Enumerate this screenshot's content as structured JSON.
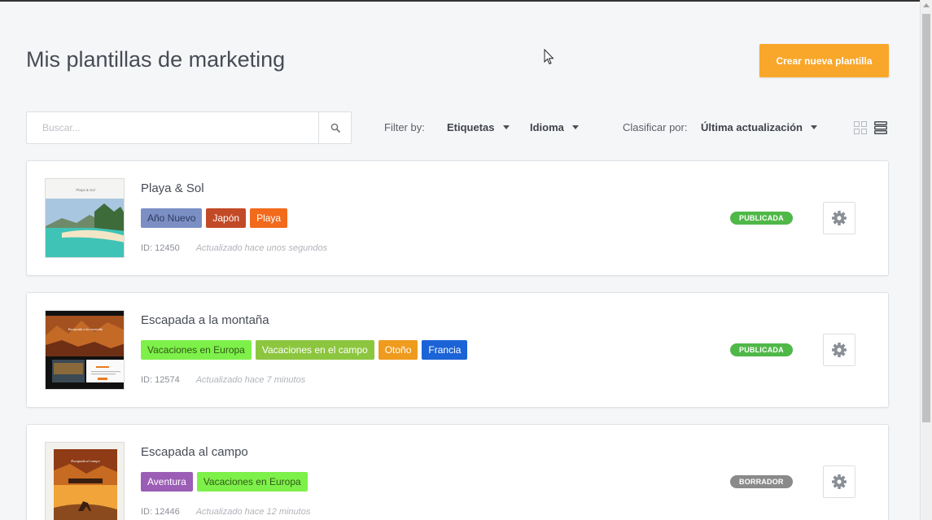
{
  "page": {
    "title": "Mis plantillas de marketing"
  },
  "actions": {
    "create_label": "Crear nueva plantilla"
  },
  "search": {
    "placeholder": "Buscar..."
  },
  "filters": {
    "filter_by_label": "Filter by:",
    "tags_label": "Etiquetas",
    "language_label": "Idioma",
    "sort_label": "Clasificar por:",
    "sort_value": "Última actualización"
  },
  "templates": [
    {
      "title": "Playa & Sol",
      "tags": [
        {
          "label": "Año Nuevo",
          "color": "#7b8fc4",
          "text_color": "#2c3a5e"
        },
        {
          "label": "Japón",
          "color": "#c24a26",
          "text_color": "#ffffff"
        },
        {
          "label": "Playa",
          "color": "#f26a1b",
          "text_color": "#ffffff"
        }
      ],
      "id_label": "ID: 12450",
      "updated": "Actualizado hace unos segundos",
      "status": "PUBLICADA",
      "status_color": "#4fb848",
      "thumb_text": "Playa & Sol"
    },
    {
      "title": "Escapada a la montaña",
      "tags": [
        {
          "label": "Vacaciones en Europa",
          "color": "#7ef04a",
          "text_color": "#2f5a17"
        },
        {
          "label": "Vacaciones en el campo",
          "color": "#8cc63f",
          "text_color": "#ffffff"
        },
        {
          "label": "Otoño",
          "color": "#ee9b1e",
          "text_color": "#ffffff"
        },
        {
          "label": "Francia",
          "color": "#1b63d6",
          "text_color": "#ffffff"
        }
      ],
      "id_label": "ID: 12574",
      "updated": "Actualizado hace 7 minutos",
      "status": "PUBLICADA",
      "status_color": "#4fb848",
      "thumb_text": "Escapada a la montaña"
    },
    {
      "title": "Escapada al campo",
      "tags": [
        {
          "label": "Aventura",
          "color": "#9b5db5",
          "text_color": "#ffffff"
        },
        {
          "label": "Vacaciones en Europa",
          "color": "#7ef04a",
          "text_color": "#2f5a17"
        }
      ],
      "id_label": "ID: 12446",
      "updated": "Actualizado hace 12 minutos",
      "status": "BORRADOR",
      "status_color": "#8a8a8a",
      "thumb_text": "Escapada al campo"
    }
  ],
  "colors": {
    "accent": "#f9a72b",
    "published": "#4fb848",
    "draft": "#8a8a8a"
  }
}
